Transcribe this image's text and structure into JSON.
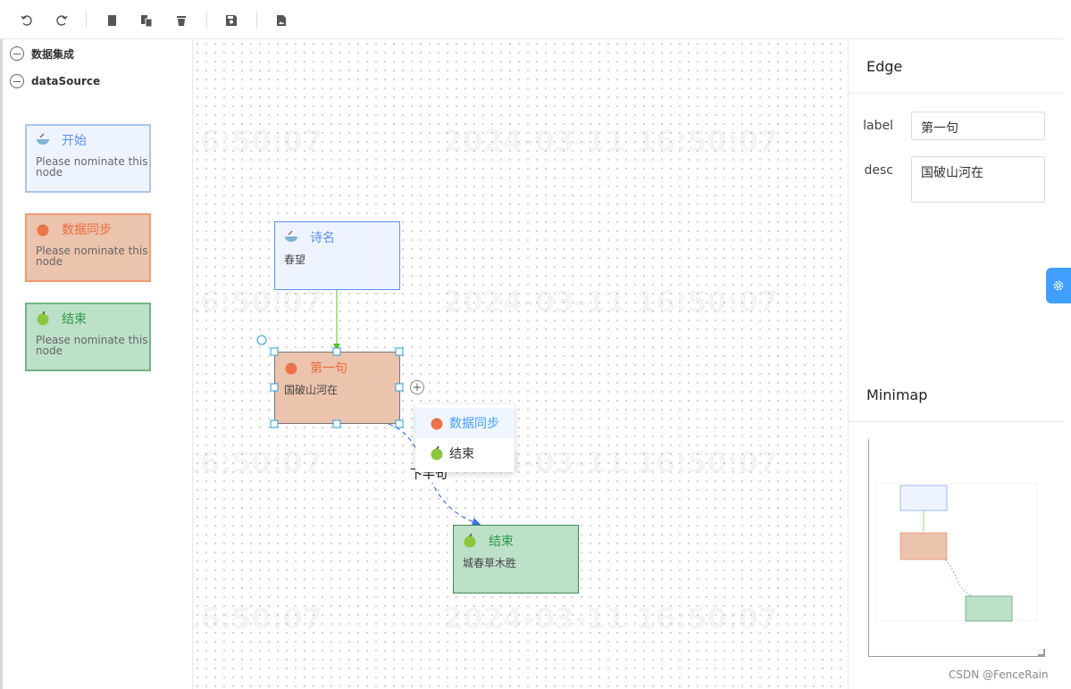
{
  "toolbar": {
    "buttons": [
      "undo-icon",
      "redo-icon",
      "copy-icon",
      "paste-icon",
      "delete-icon",
      "save-icon",
      "export-image-icon"
    ]
  },
  "sidebar": {
    "groups": [
      {
        "label": "数据集成"
      },
      {
        "label": "dataSource"
      }
    ],
    "stencils": [
      {
        "title": "开始",
        "desc": "Please nominate this node",
        "color": "#5b8ff9",
        "bg": "#eef4ff",
        "border": "#9ebcf2"
      },
      {
        "title": "数据同步",
        "desc": "Please nominate this node",
        "color": "#ed7d51",
        "bg": "#ecc3ad",
        "border": "#ef9b72"
      },
      {
        "title": "结束",
        "desc": "Please nominate this node",
        "color": "#3aa053",
        "bg": "#bde0c9",
        "border": "#6fb685"
      }
    ]
  },
  "canvas": {
    "nodes": [
      {
        "title": "诗名",
        "desc": "春望"
      },
      {
        "title": "第一句",
        "desc": "国破山河在"
      },
      {
        "title": "结束",
        "desc": "城春草木胜"
      }
    ],
    "edge_label": "下半句",
    "context_menu": [
      {
        "label": "数据同步"
      },
      {
        "label": "结束"
      }
    ]
  },
  "watermark": "2024-03-11  16:50:07",
  "edge_panel": {
    "title": "Edge",
    "label_label": "label",
    "label_value": "第一句",
    "desc_label": "desc",
    "desc_value": "国破山河在"
  },
  "minimap": {
    "title": "Minimap"
  },
  "footer": {
    "credit": "CSDN @FenceRain"
  },
  "colors": {
    "accent": "#409eff",
    "edge_green": "#52c41a",
    "edge_blue": "#3b6fe0"
  }
}
